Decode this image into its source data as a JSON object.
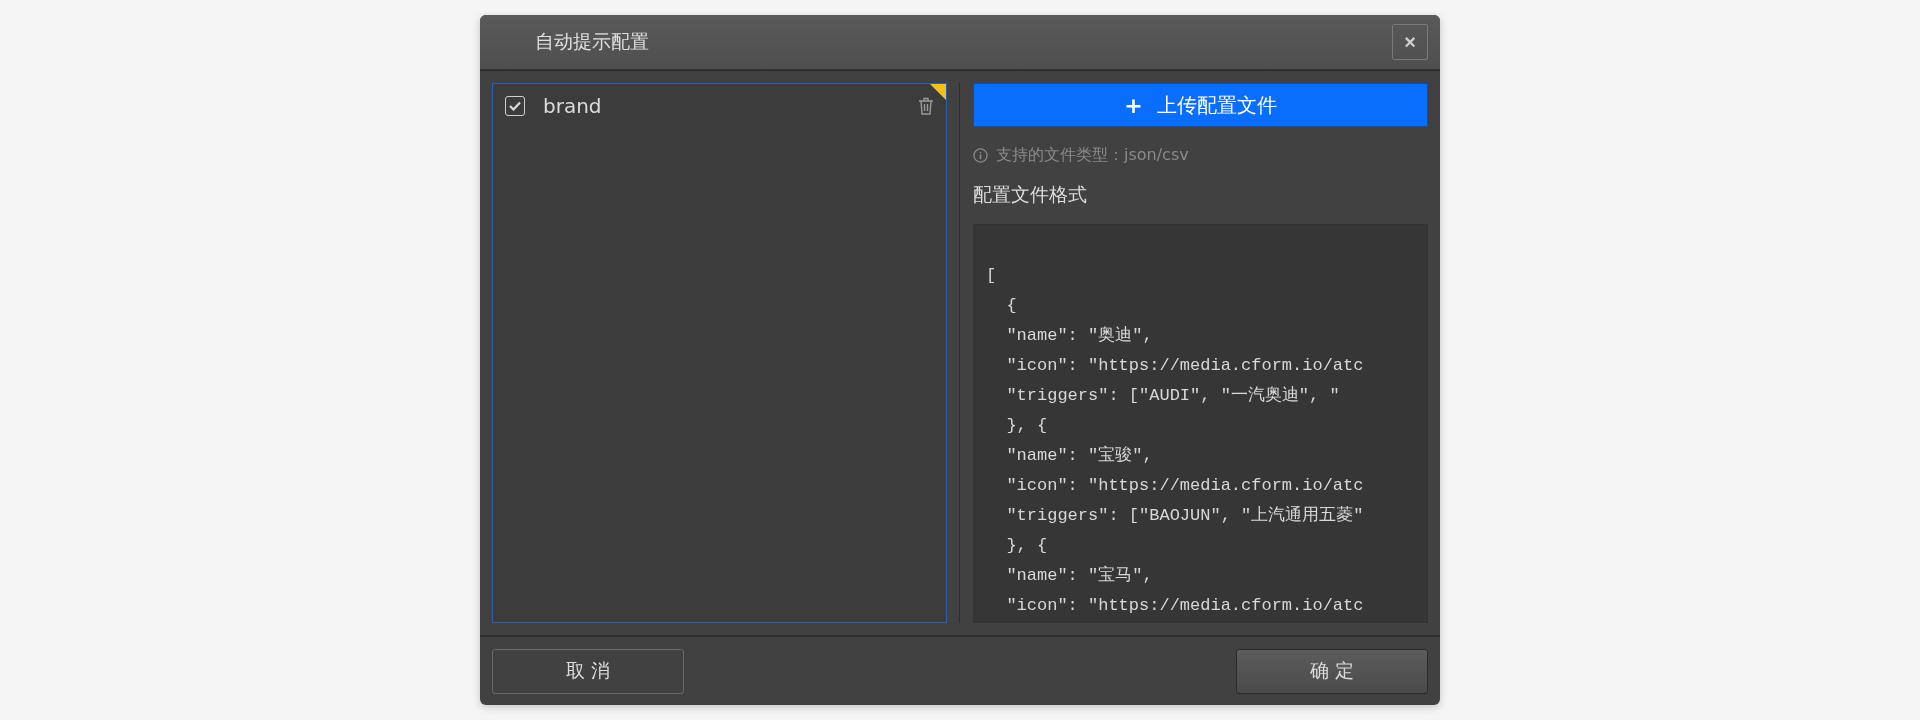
{
  "dialog": {
    "title": "自动提示配置",
    "close_label": "×"
  },
  "config_list": {
    "items": [
      {
        "label": "brand",
        "checked": true
      }
    ]
  },
  "upload_button": {
    "icon": "+",
    "label": "上传配置文件"
  },
  "supported_types": "支持的文件类型：json/csv",
  "format_title": "配置文件格式",
  "code_lines": [
    "[",
    "  {",
    "  \"name\": \"奥迪\",",
    "  \"icon\": \"https://media.cform.io/atc",
    "  \"triggers\": [\"AUDI\", \"一汽奥迪\", \"",
    "  }, {",
    "  \"name\": \"宝骏\",",
    "  \"icon\": \"https://media.cform.io/atc",
    "  \"triggers\": [\"BAOJUN\", \"上汽通用五菱\"",
    "  }, {",
    "  \"name\": \"宝马\",",
    "  \"icon\": \"https://media.cform.io/atc"
  ],
  "footer": {
    "cancel": "取 消",
    "confirm": "确 定"
  }
}
